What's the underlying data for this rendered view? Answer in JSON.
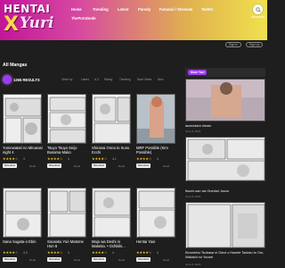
{
  "site": {
    "logo_top": "HENTAI",
    "logo_x": "X",
    "logo_bottom": "Yuri"
  },
  "nav": [
    {
      "label": "Home"
    },
    {
      "label": "Trending"
    },
    {
      "label": "Latest"
    },
    {
      "label": "Parody"
    },
    {
      "label": "Futanari / Shemale"
    },
    {
      "label": "Twitter"
    },
    {
      "label": "ThePornDude"
    }
  ],
  "header": {
    "advanced": "Advanced"
  },
  "auth": {
    "signin": "Sign In",
    "signup": "Sign Up"
  },
  "main": {
    "title": "All Mangas",
    "results": "1265 RESULTS",
    "sort_label": "Order by",
    "sort_options": [
      "Latest",
      "A-Z",
      "Rating",
      "Trending",
      "Most Views",
      "New"
    ]
  },
  "cards": [
    {
      "title": "Yumewatari no Minarasi night 4",
      "stars": "★★★★☆",
      "rating": "4",
      "tag": "Oneshot",
      "chip": "Read"
    },
    {
      "title": "Tsuyo Tsuyo Seijo Busama Mako",
      "stars": "★★★★☆",
      "rating": "4",
      "tag": "Oneshot",
      "chip": "Read"
    },
    {
      "title": "Shiranai Onna to Sunu Ecchi",
      "stars": "★★★★☆",
      "rating": "4.1",
      "tag": "Oneshot",
      "chip": "Read"
    },
    {
      "title": "MRF Possible (Kim Possible)",
      "stars": "★★★★☆",
      "rating": "4",
      "tag": "Oneshot",
      "chip": "Read"
    },
    {
      "title": "Sana Sugata-o Ebin",
      "stars": "★★★★☆",
      "rating": "4.3",
      "tag": "Oneshot",
      "chip": "Read"
    },
    {
      "title": "Sousaku Yuri Matome Hon 6",
      "stars": "★★★★☆",
      "rating": "4",
      "tag": "Oneshot",
      "chip": "Read"
    },
    {
      "title": "Majo wa Deshi ni Makeita. • Ochikiki...",
      "stars": "★★★★☆",
      "rating": "4",
      "tag": "Oneshot",
      "chip": "Read"
    },
    {
      "title": "Hentai Yaoi",
      "stars": "★★★★☆",
      "rating": "4",
      "tag": "Oneshot",
      "chip": "Read"
    }
  ],
  "sidebar": {
    "header": "More Yuri",
    "items": [
      {
        "title": "ascendant dream",
        "date": "June 8, 2023"
      },
      {
        "title": "Itsumi-san wa Onedari Jouzu",
        "date": "June 8, 2023"
      },
      {
        "title": "Kiramekiu Tsubasa ni Omoi o Hasete Tadoku to Oro, Watashi no Yuusei",
        "date": "June 8, 2023"
      }
    ]
  },
  "colors": {
    "header_gradient_start": "#c2159a",
    "header_gradient_end": "#f0e14e",
    "accent": "#9a3cf5",
    "background": "#1e1e1e",
    "star": "#f4c430"
  },
  "icons": [
    "search-icon",
    "book-icon"
  ]
}
